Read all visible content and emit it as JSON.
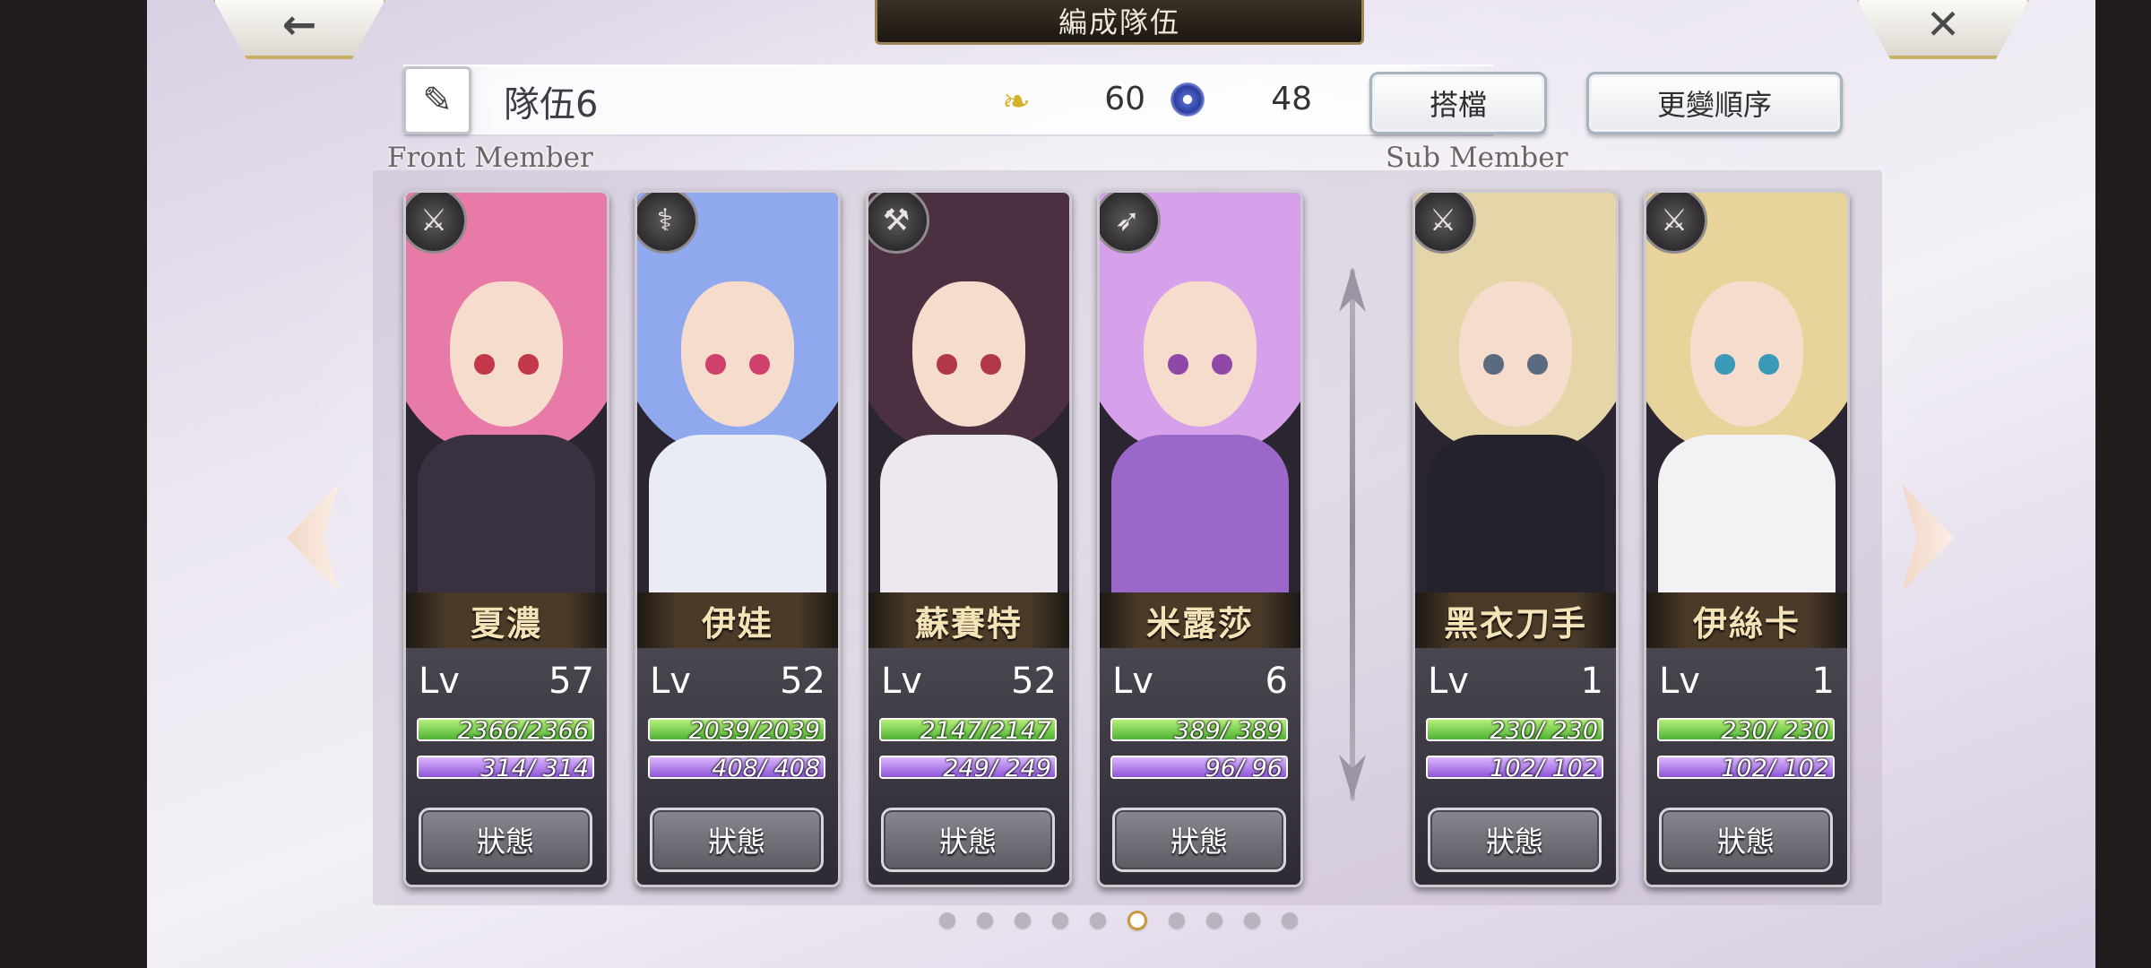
{
  "header": {
    "title": "編成隊伍",
    "back_icon": "←",
    "close_icon": "✕"
  },
  "team": {
    "name": "隊伍6",
    "edit_icon": "✎",
    "wing_icon": "❧",
    "wing_value": "60",
    "swirl_value": "48"
  },
  "buttons": {
    "partner": "搭檔",
    "change_order": "更變順序"
  },
  "sections": {
    "front": "Front Member",
    "sub": "Sub Member"
  },
  "lv_label": "Lv",
  "status_label": "狀態",
  "front_members": [
    {
      "name": "夏濃",
      "weapon_icon": "⚔",
      "lv": "57",
      "hp": "2366/2366",
      "mp": "314/ 314",
      "hp_frac": 1,
      "mp_frac": 1,
      "hair": "#e87aa8",
      "eye": "#c23848",
      "body": "#3a3140"
    },
    {
      "name": "伊娃",
      "weapon_icon": "⚕",
      "lv": "52",
      "hp": "2039/2039",
      "mp": "408/ 408",
      "hp_frac": 1,
      "mp_frac": 1,
      "hair": "#8fa8ee",
      "eye": "#d0406c",
      "body": "#e9ecf5"
    },
    {
      "name": "蘇賽特",
      "weapon_icon": "⚒",
      "lv": "52",
      "hp": "2147/2147",
      "mp": "249/ 249",
      "hp_frac": 1,
      "mp_frac": 1,
      "hair": "#4a3040",
      "eye": "#b03848",
      "body": "#ece8ee"
    },
    {
      "name": "米露莎",
      "weapon_icon": "➶",
      "lv": "6",
      "hp": "389/ 389",
      "mp": "96/ 96",
      "hp_frac": 1,
      "mp_frac": 1,
      "hair": "#d7a0ea",
      "eye": "#9048a8",
      "body": "#9a68c8"
    }
  ],
  "sub_members": [
    {
      "name": "黑衣刀手",
      "weapon_icon": "⚔",
      "lv": "1",
      "hp": "230/ 230",
      "mp": "102/ 102",
      "hp_frac": 1,
      "mp_frac": 1,
      "hair": "#e4d6a8",
      "eye": "#5a6a80",
      "body": "#24222a"
    },
    {
      "name": "伊絲卡",
      "weapon_icon": "⚔",
      "lv": "1",
      "hp": "230/ 230",
      "mp": "102/ 102",
      "hp_frac": 1,
      "mp_frac": 1,
      "hair": "#e8d49a",
      "eye": "#3a9ab8",
      "body": "#f2f2f4"
    }
  ],
  "pagination": {
    "total": 10,
    "current": 6
  },
  "colors": {
    "accent_gold": "#c9b06a",
    "hp_green": "#4fb334",
    "mp_purple": "#8d55d6"
  }
}
